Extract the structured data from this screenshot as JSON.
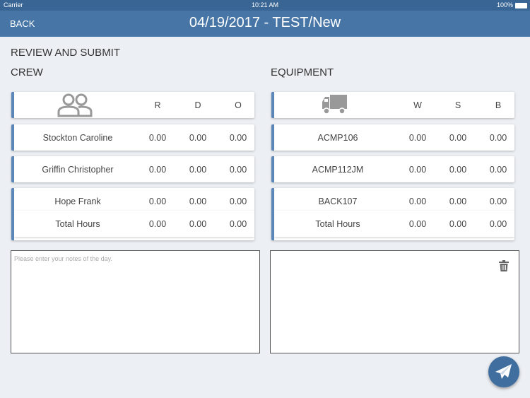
{
  "status": {
    "carrier": "Carrier",
    "time": "10:21 AM",
    "battery": "100%"
  },
  "nav": {
    "back": "BACK",
    "title": "04/19/2017 - TEST/New"
  },
  "page_title": "REVIEW AND SUBMIT",
  "crew": {
    "heading": "CREW",
    "icon": "people-icon",
    "cols": [
      "R",
      "D",
      "O"
    ],
    "rows": [
      {
        "name": "Stockton Caroline",
        "v": [
          "0.00",
          "0.00",
          "0.00"
        ]
      },
      {
        "name": "Griffin Christopher",
        "v": [
          "0.00",
          "0.00",
          "0.00"
        ]
      },
      {
        "name": "Hope Frank",
        "v": [
          "0.00",
          "0.00",
          "0.00"
        ]
      }
    ],
    "total": {
      "name": "Total Hours",
      "v": [
        "0.00",
        "0.00",
        "0.00"
      ]
    }
  },
  "equipment": {
    "heading": "EQUIPMENT",
    "icon": "truck-icon",
    "cols": [
      "W",
      "S",
      "B"
    ],
    "rows": [
      {
        "name": "ACMP106",
        "v": [
          "0.00",
          "0.00",
          "0.00"
        ]
      },
      {
        "name": "ACMP112JM",
        "v": [
          "0.00",
          "0.00",
          "0.00"
        ]
      },
      {
        "name": "BACK107",
        "v": [
          "0.00",
          "0.00",
          "0.00"
        ]
      }
    ],
    "total": {
      "name": "Total Hours",
      "v": [
        "0.00",
        "0.00",
        "0.00"
      ]
    }
  },
  "notes": {
    "placeholder": "Please enter your notes of the day.",
    "value": ""
  },
  "colors": {
    "nav": "#4675a6",
    "accent": "#5b86b8"
  }
}
